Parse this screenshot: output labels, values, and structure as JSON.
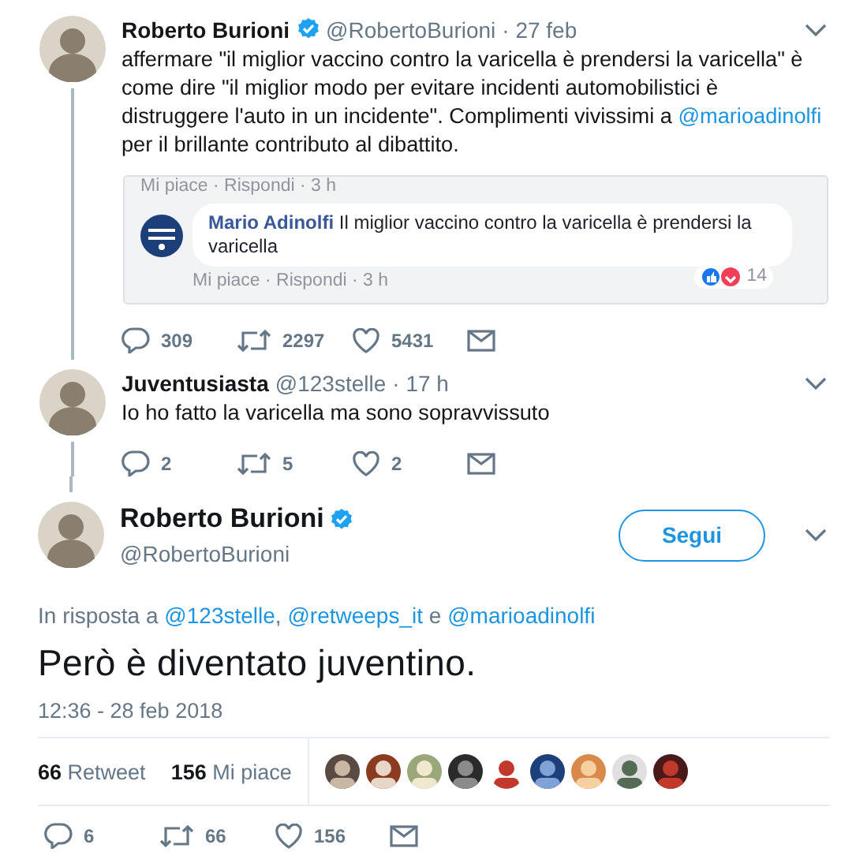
{
  "thread": [
    {
      "name": "Roberto Burioni",
      "verified": true,
      "handle": "@RobertoBurioni",
      "time": "· 27 feb",
      "text": [
        {
          "kind": "plain",
          "text": "affermare \"il miglior vaccino contro la varicella è prendersi la varicella\" è come dire \"il miglior modo per evitare incidenti automobilistici è distruggere l'auto in un incidente\". Complimenti vivissimi a "
        },
        {
          "kind": "mention",
          "text": "@marioadinolfi"
        },
        {
          "kind": "plain",
          "text": " per il brillante contributo al dibattito."
        }
      ],
      "comment_screenshot": {
        "top_line": "Mi piace · Rispondi · 3 h",
        "author": "Mario Adinolfi",
        "text": "Il miglior vaccino contro la varicella è prendersi la varicella",
        "meta": "Mi piace · Rispondi · 3 h",
        "reaction_count": "14"
      },
      "actions": [
        {
          "kind": "reply",
          "count": "309"
        },
        {
          "kind": "retweet",
          "count": "2297"
        },
        {
          "kind": "like",
          "count": "5431"
        },
        {
          "kind": "message"
        }
      ]
    },
    {
      "name": "Juventusiasta",
      "verified": false,
      "handle": "@123stelle",
      "time": "· 17 h",
      "text": [
        {
          "kind": "plain",
          "text": "Io ho fatto la varicella ma sono sopravvissuto"
        }
      ],
      "actions": [
        {
          "kind": "reply",
          "count": "2"
        },
        {
          "kind": "retweet",
          "count": "5"
        },
        {
          "kind": "like",
          "count": "2"
        },
        {
          "kind": "message"
        }
      ]
    }
  ],
  "main_tweet": {
    "name": "Roberto Burioni",
    "verified": true,
    "handle": "@RobertoBurioni",
    "follow_button": "Segui",
    "reply_to": [
      {
        "kind": "plain",
        "text": "In risposta a "
      },
      {
        "kind": "mention",
        "text": "@123stelle"
      },
      {
        "kind": "plain",
        "text": ", "
      },
      {
        "kind": "mention",
        "text": "@retweeps_it"
      },
      {
        "kind": "plain",
        "text": " e "
      },
      {
        "kind": "mention",
        "text": "@marioadinolfi"
      }
    ],
    "text": "Però è diventato juventino.",
    "timestamp": "12:36 - 28 feb 2018",
    "stats": [
      {
        "count": "66",
        "label": "Retweet"
      },
      {
        "count": "156",
        "label": "Mi piace"
      }
    ],
    "actions": [
      {
        "kind": "reply",
        "count": "6"
      },
      {
        "kind": "retweet",
        "count": "66"
      },
      {
        "kind": "like",
        "count": "156"
      },
      {
        "kind": "message"
      }
    ]
  }
}
